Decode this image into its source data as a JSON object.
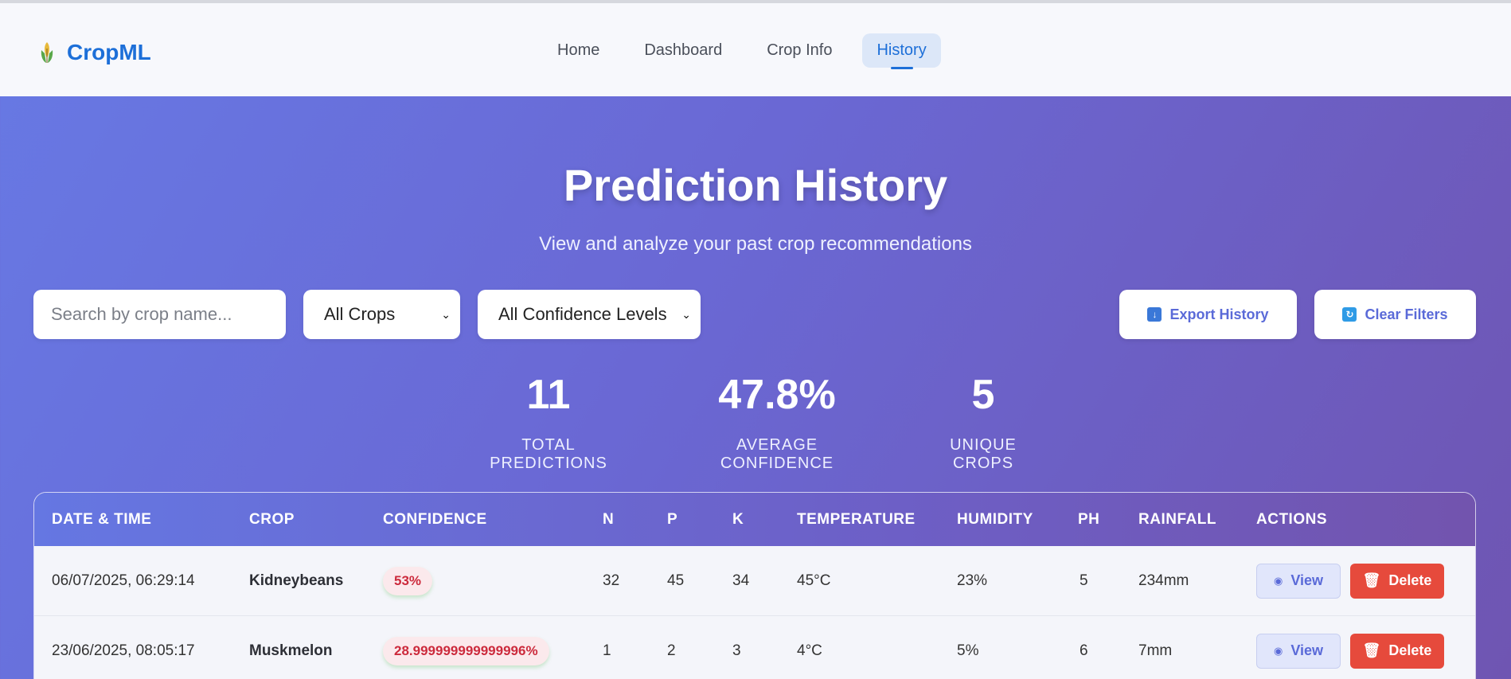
{
  "brand": {
    "name": "CropML",
    "icon": "corn-icon"
  },
  "nav": {
    "items": [
      {
        "label": "Home",
        "active": false
      },
      {
        "label": "Dashboard",
        "active": false
      },
      {
        "label": "Crop Info",
        "active": false
      },
      {
        "label": "History",
        "active": true
      }
    ]
  },
  "hero": {
    "title": "Prediction History",
    "subtitle": "View and analyze your past crop recommendations"
  },
  "filters": {
    "search_placeholder": "Search by crop name...",
    "crop_select": "All Crops",
    "confidence_select": "All Confidence Levels",
    "export_label": "Export History",
    "clear_label": "Clear Filters"
  },
  "stats": [
    {
      "value": "11",
      "label": "TOTAL PREDICTIONS"
    },
    {
      "value": "47.8%",
      "label": "AVERAGE CONFIDENCE"
    },
    {
      "value": "5",
      "label": "UNIQUE CROPS"
    }
  ],
  "table": {
    "headers": [
      "DATE & TIME",
      "CROP",
      "CONFIDENCE",
      "N",
      "P",
      "K",
      "TEMPERATURE",
      "HUMIDITY",
      "PH",
      "RAINFALL",
      "ACTIONS"
    ],
    "rows": [
      {
        "datetime": "06/07/2025, 06:29:14",
        "crop": "Kidneybeans",
        "confidence": "53%",
        "n": "32",
        "p": "45",
        "k": "34",
        "temperature": "45°C",
        "humidity": "23%",
        "ph": "5",
        "rainfall": "234mm"
      },
      {
        "datetime": "23/06/2025, 08:05:17",
        "crop": "Muskmelon",
        "confidence": "28.999999999999996%",
        "n": "1",
        "p": "2",
        "k": "3",
        "temperature": "4°C",
        "humidity": "5%",
        "ph": "6",
        "rainfall": "7mm"
      }
    ],
    "view_label": "View",
    "delete_label": "Delete"
  },
  "colors": {
    "accent": "#1d6fd8",
    "danger": "#e64a3c",
    "badge_text": "#cc2a3c"
  }
}
